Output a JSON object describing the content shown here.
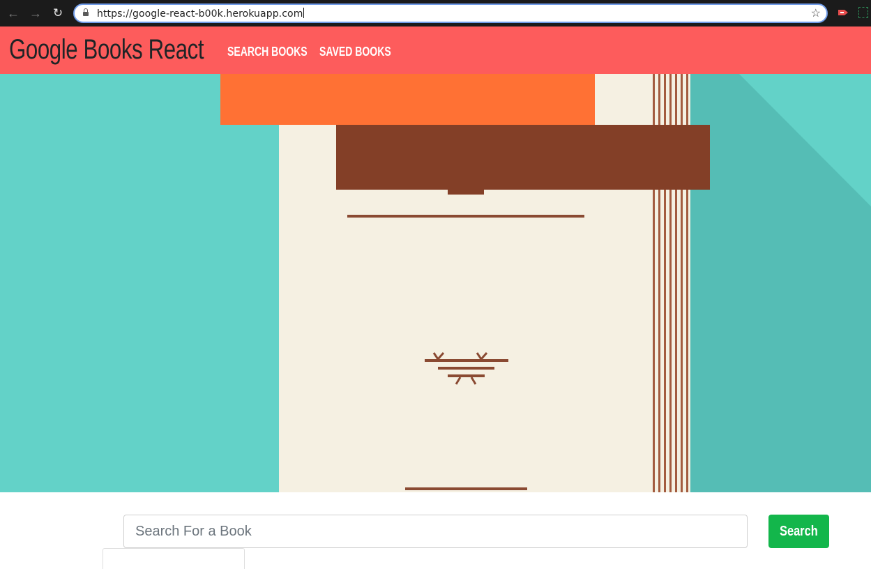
{
  "browser": {
    "url": "https://google-react-b00k.herokuapp.com",
    "icons": [
      "back-arrow-icon",
      "forward-arrow-icon",
      "reload-icon",
      "lock-icon",
      "bookmark-star-icon",
      "extension-icon"
    ]
  },
  "navbar": {
    "brand": "Google Books React",
    "links": [
      {
        "label": "SEARCH BOOKS"
      },
      {
        "label": "SAVED BOOKS"
      }
    ],
    "background": "#fd5c5c"
  },
  "hero": {
    "background": "#63d2c8",
    "book_color": "#f5f0e2",
    "band_color": "#ff7134",
    "ribbon_color": "#833f27"
  },
  "search": {
    "placeholder": "Search For a Book",
    "value": "",
    "button_label": "Search",
    "button_color": "#13b64b"
  }
}
